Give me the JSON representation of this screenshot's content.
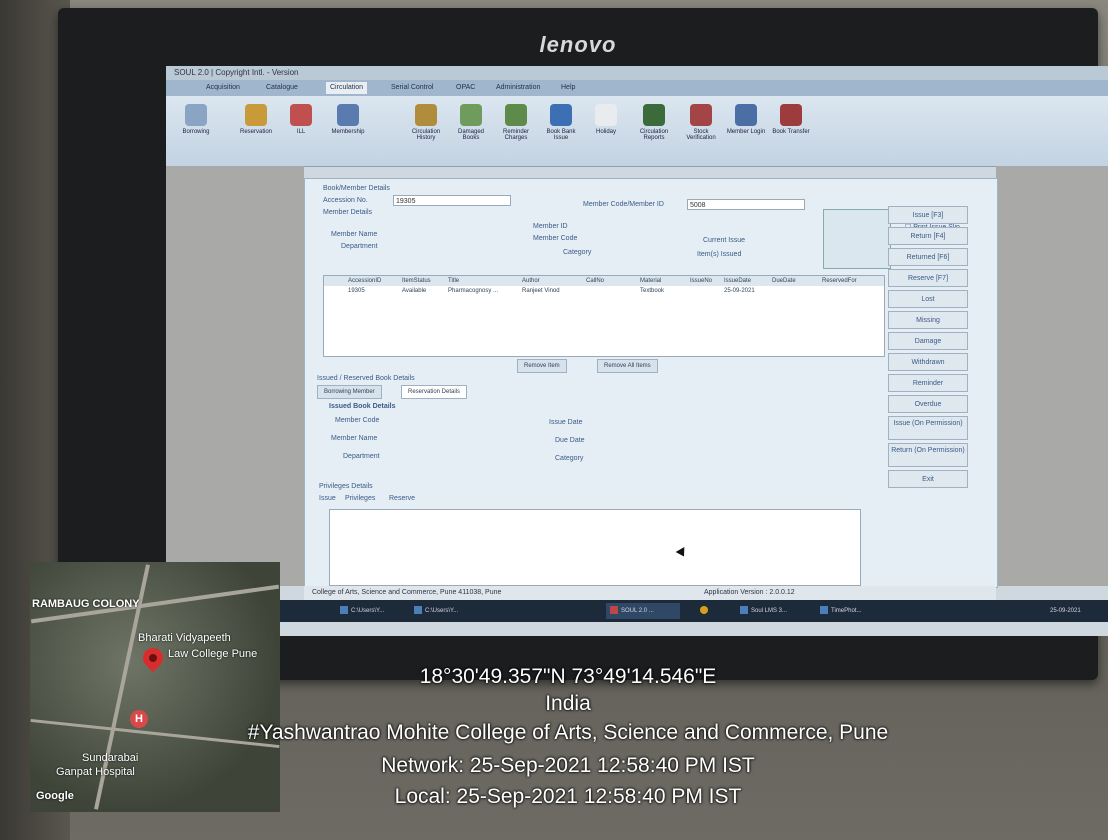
{
  "monitor": {
    "brand": "lenovo"
  },
  "app": {
    "title": "SOUL 2.0 | Copyright Intl. - Version",
    "menu_tabs": [
      "Acquisition",
      "Catalogue",
      "Circulation",
      "Serial Control",
      "OPAC",
      "Administration",
      "Help"
    ],
    "ribbon_buttons": [
      "Borrowing",
      "Reservation",
      "ILL",
      "Membership",
      "Circulation History",
      "Damaged Books",
      "Reminder Charges",
      "Book Bank Issue",
      "Holiday",
      "Circulation Reports",
      "Stock Verification",
      "Member Login",
      "Book Transfer"
    ],
    "form": {
      "heading": "Book/Member Details",
      "accession_label": "Accession No.",
      "accession_value": "19305",
      "member_details_label": "Member Details",
      "member_code_label": "Member Code/Member ID",
      "member_code_value": "5008",
      "member_id_label": "Member ID",
      "member_name_label": "Member Name",
      "member_code2_label": "Member Code",
      "department_label": "Department",
      "category_label": "Category",
      "current_issue_label": "Current Issue",
      "items_issued_label": "Item(s) Issued",
      "print_issue_slip": "Print Issue Slip",
      "grid_headers": [
        "AccessionID",
        "ItemStatus",
        "Title",
        "Author",
        "CallNo",
        "Material",
        "IssueNo",
        "IssueDate",
        "DueDate",
        "ReservedFor"
      ],
      "grid_row": [
        "19305",
        "Available",
        "Pharmacognosy ...",
        "Ranjeet Vinod",
        "",
        "Textbook",
        "",
        "25-09-2021",
        "",
        ""
      ],
      "remove_item": "Remove Item",
      "remove_all": "Remove All Items",
      "issued_section": "Issued / Reserved Book Details",
      "tab_borrowing": "Borrowing Member",
      "tab_reservation": "Reservation Details",
      "issued_book_details": "Issued Book Details",
      "member_code3": "Member Code",
      "member_name3": "Member Name",
      "department3": "Department",
      "issue_date": "Issue Date",
      "due_date": "Due Date",
      "category3": "Category",
      "privileges": "Privileges Details",
      "priv_tabs": [
        "Issue",
        "Privileges",
        "Reserve"
      ]
    },
    "side_buttons": [
      "Issue [F3]",
      "Return [F4]",
      "Returned [F6]",
      "Reserve [F7]",
      "Lost",
      "Missing",
      "Damage",
      "Withdrawn",
      "Reminder",
      "Overdue",
      "Issue (On Permission)",
      "Return (On Permission)",
      "Exit"
    ],
    "status_left": "College of Arts, Science and Commerce, Pune 411038, Pune",
    "status_right": "Application Version : 2.0.0.12",
    "taskbar_items": [
      "C:\\Users\\Y...",
      "C:\\Users\\Y...",
      "SOUL 2.0 ...",
      "Soul LMS 3...",
      "TimePhot..."
    ],
    "taskbar_date": "25-09-2021"
  },
  "map": {
    "labels": [
      "RAMBAUG COLONY",
      "Bharati Vidyapeeth",
      "Law College Pune",
      "Sundarabai",
      "Ganpat Hospital",
      "Google"
    ],
    "hospital_mark": "H"
  },
  "overlay": {
    "coords": "18°30'49.357\"N 73°49'14.546\"E",
    "country": "India",
    "place": "#Yashwantrao Mohite College of Arts, Science and Commerce, Pune",
    "network_time": "Network: 25-Sep-2021 12:58:40 PM IST",
    "local_time": "Local: 25-Sep-2021 12:58:40 PM IST"
  }
}
